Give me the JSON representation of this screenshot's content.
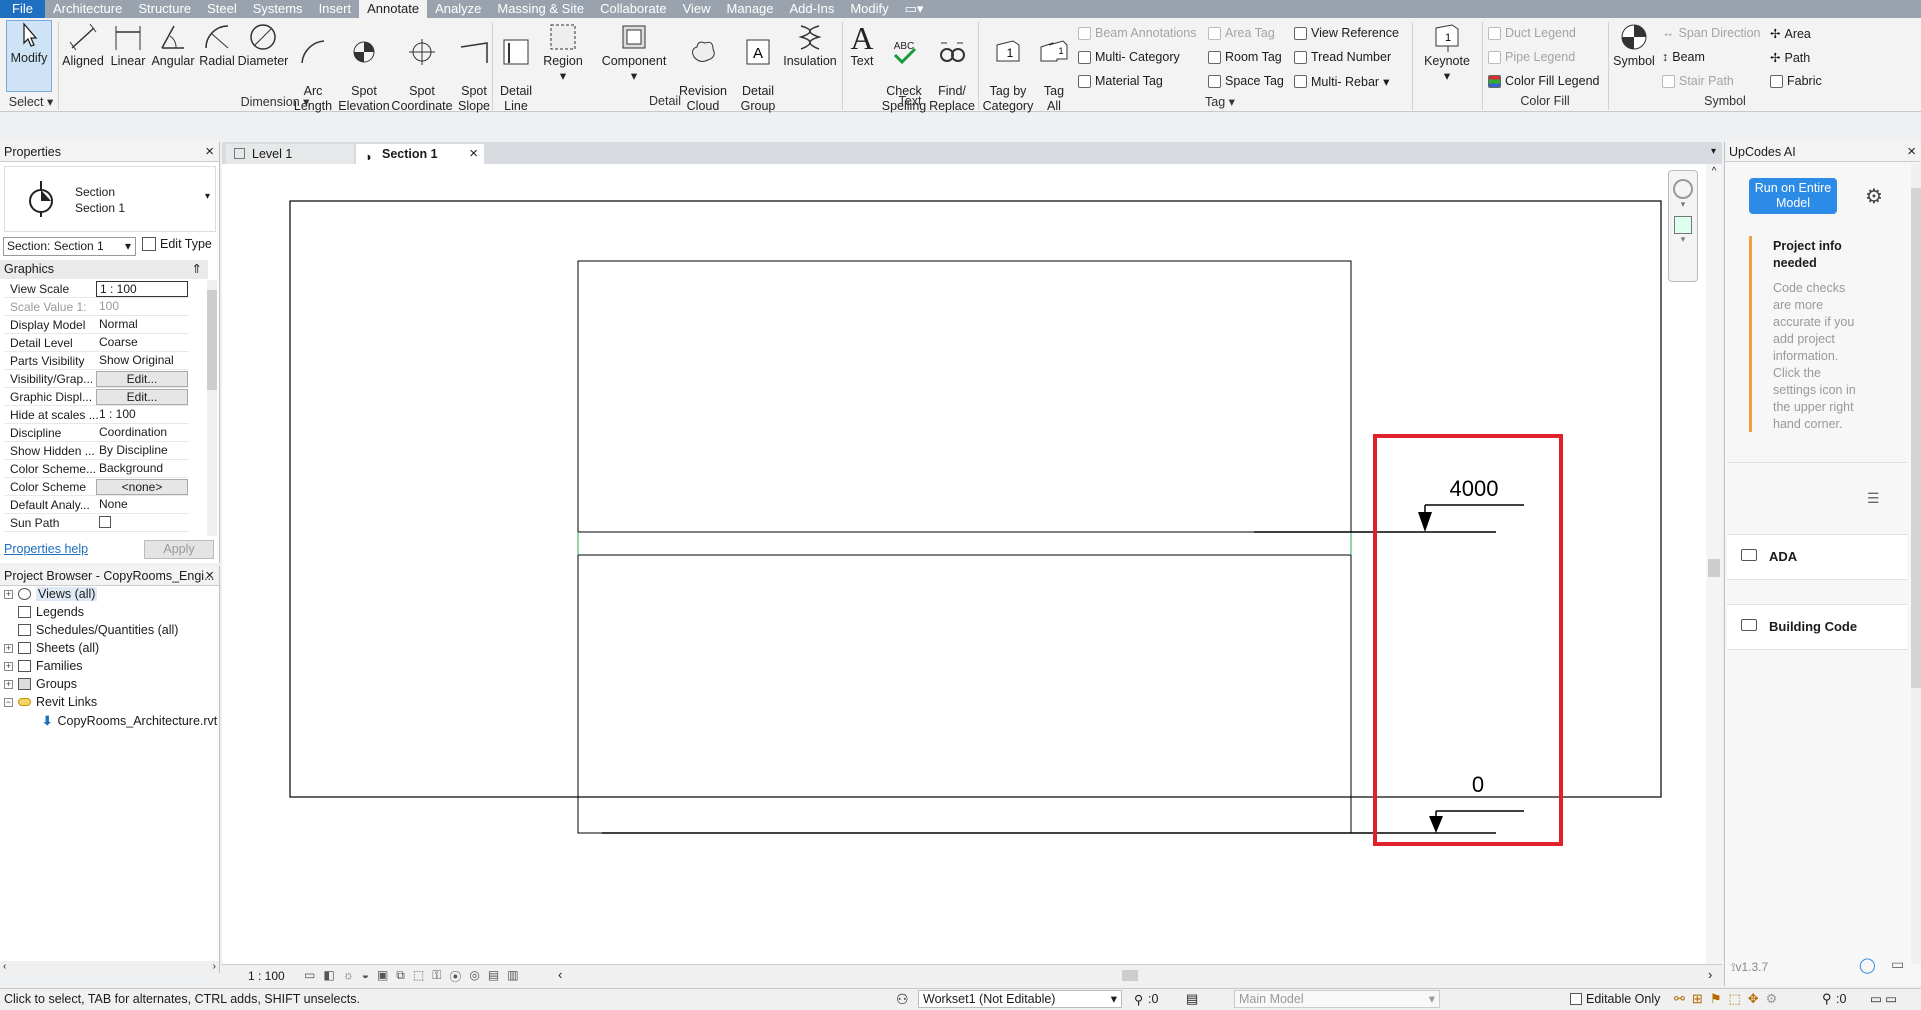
{
  "menu": {
    "file": "File",
    "tabs": [
      "Architecture",
      "Structure",
      "Steel",
      "Systems",
      "Insert",
      "Annotate",
      "Analyze",
      "Massing & Site",
      "Collaborate",
      "View",
      "Manage",
      "Add-Ins",
      "Modify"
    ],
    "active_tab": "Annotate"
  },
  "ribbon": {
    "select": {
      "modify": "Modify",
      "group": "Select"
    },
    "dimension": {
      "group": "Dimension",
      "tools": [
        "Aligned",
        "Linear",
        "Angular",
        "Radial",
        "Diameter",
        "Arc\nLength",
        "Spot\nElevation",
        "Spot\nCoordinate",
        "Spot\nSlope"
      ]
    },
    "detail": {
      "group": "Detail",
      "tools": [
        "Detail\nLine",
        "Region",
        "Component",
        "Revision\nCloud",
        "Detail\nGroup",
        "Insulation"
      ]
    },
    "text": {
      "group": "Text",
      "tools": [
        "Text",
        "Check\nSpelling",
        "Find/\nReplace"
      ]
    },
    "tag": {
      "group": "Tag",
      "tools": [
        "Tag by\nCategory",
        "Tag\nAll"
      ],
      "small": [
        "Beam Annotations",
        "Multi- Category",
        "Material Tag",
        "Area Tag",
        "Room Tag",
        "Space Tag",
        "View Reference",
        "Tread Number",
        "Multi- Rebar"
      ]
    },
    "keynote": "Keynote",
    "color_fill": {
      "group": "Color Fill",
      "items": [
        "Duct Legend",
        "Pipe Legend",
        "Color Fill Legend"
      ]
    },
    "symbol": {
      "group": "Symbol",
      "tool": "Symbol",
      "items": [
        "Span Direction",
        "Beam",
        "Stair Path",
        "Area",
        "Path",
        "Fabric"
      ]
    }
  },
  "properties": {
    "title": "Properties",
    "type_line1": "Section",
    "type_line2": "Section 1",
    "selector": "Section: Section 1",
    "edit_type": "Edit Type",
    "category": "Graphics",
    "rows": [
      {
        "k": "View Scale",
        "v": "1 : 100"
      },
      {
        "k": "Scale Value    1:",
        "v": "100"
      },
      {
        "k": "Display Model",
        "v": "Normal"
      },
      {
        "k": "Detail Level",
        "v": "Coarse"
      },
      {
        "k": "Parts Visibility",
        "v": "Show Original"
      },
      {
        "k": "Visibility/Grap...",
        "v": "Edit..."
      },
      {
        "k": "Graphic Displ...",
        "v": "Edit..."
      },
      {
        "k": "Hide at scales ...",
        "v": "1 : 100"
      },
      {
        "k": "Discipline",
        "v": "Coordination"
      },
      {
        "k": "Show Hidden ...",
        "v": "By Discipline"
      },
      {
        "k": "Color Scheme...",
        "v": "Background"
      },
      {
        "k": "Color Scheme",
        "v": "<none>"
      },
      {
        "k": "Default Analy...",
        "v": "None"
      },
      {
        "k": "Sun Path",
        "v": ""
      }
    ],
    "help": "Properties help",
    "apply": "Apply"
  },
  "browser": {
    "title": "Project Browser - CopyRooms_Engi...",
    "items": [
      "Views (all)",
      "Legends",
      "Schedules/Quantities (all)",
      "Sheets (all)",
      "Families",
      "Groups",
      "Revit Links",
      "CopyRooms_Architecture.rvt"
    ]
  },
  "view_tabs": [
    "Level 1",
    "Section 1"
  ],
  "active_view": "Section 1",
  "drawing": {
    "elev_top": "4000",
    "elev_bottom": "0",
    "highlight_color": "#e0202a"
  },
  "view_scale": "1 : 100",
  "upcodes": {
    "title": "UpCodes AI",
    "run": "Run on Entire Model",
    "info_title": "Project info needed",
    "info_text": "Code checks are more accurate if you add project information. Click the settings icon in the upper right hand corner.",
    "folders": [
      "ADA",
      "Building Code"
    ],
    "version": "v1.3.7"
  },
  "status": {
    "hint": "Click to select, TAB for alternates, CTRL adds, SHIFT unselects.",
    "workset": "Workset1 (Not Editable)",
    "zero": ":0",
    "model": "Main Model",
    "editable_only": "Editable Only",
    "filter_count": ":0"
  },
  "colors": {
    "accent": "#1f6fc1",
    "highlight": "#e0202a",
    "ribbon_bg": "#f3f3f3"
  }
}
